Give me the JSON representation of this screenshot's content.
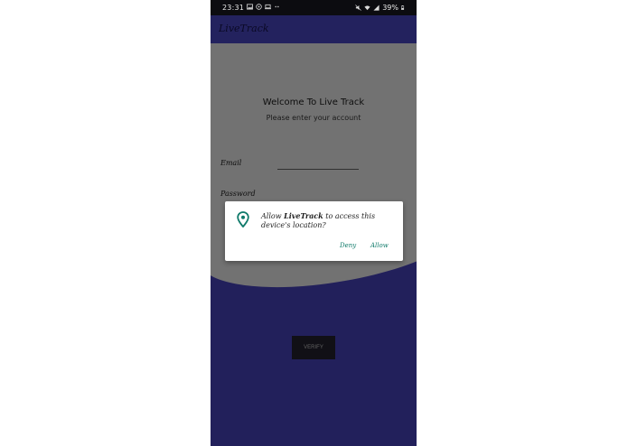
{
  "status_bar": {
    "time": "23:31",
    "battery": "39%",
    "icons": [
      "image-icon",
      "whatsapp-icon",
      "laptop-icon",
      "more-dots-icon",
      "mute-icon",
      "wifi-icon",
      "signal-icon",
      "battery-icon"
    ]
  },
  "app_bar": {
    "title": "LiveTrack"
  },
  "login": {
    "welcome": "Welcome To Live Track",
    "subtitle": "Please enter your account",
    "email_label": "Email",
    "email_value": "",
    "password_label": "Password",
    "verify_label": "VERIFY"
  },
  "dialog": {
    "message_prefix": "Allow ",
    "app_name": "LiveTrack",
    "message_suffix": " to access this device's location?",
    "deny_label": "Deny",
    "allow_label": "Allow"
  },
  "colors": {
    "app_bar": "#2b2a73",
    "background": "#2a2870",
    "panel": "#8b8b8b",
    "accent": "#0f7a6a"
  }
}
